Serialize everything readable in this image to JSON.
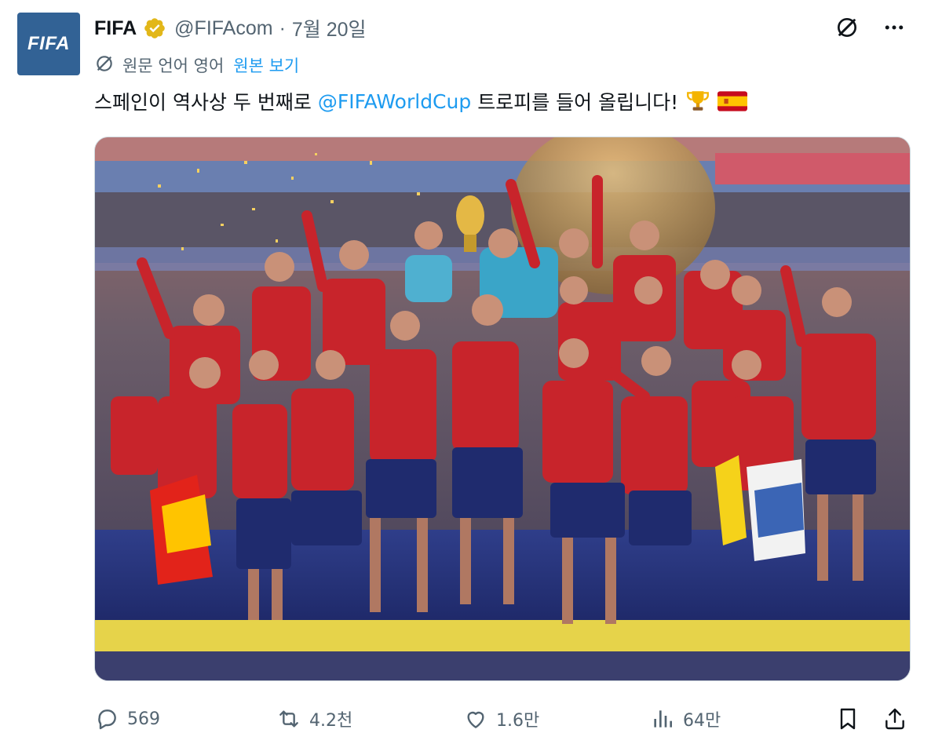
{
  "account": {
    "avatar_text": "FIFA",
    "name": "FIFA",
    "handle": "@FIFAcom",
    "separator": "·",
    "date": "7월 20일",
    "verified_color": "#e2b719",
    "avatar_color": "#326295"
  },
  "translation": {
    "source_label": "원문 언어 영어",
    "show_original": "원본 보기"
  },
  "tweet": {
    "text_before": "스페인이 역사상 두 번째로",
    "mention": "@FIFAWorldCup",
    "text_after": "트로피를 들어 올립니다!",
    "emojis": [
      "trophy-icon",
      "spain-flag-icon"
    ]
  },
  "media": {
    "description_icon": "photo"
  },
  "actions": {
    "replies": "569",
    "retweets": "4.2천",
    "likes": "1.6만",
    "views": "64만"
  },
  "colors": {
    "link": "#1d9bf0",
    "muted": "#536471",
    "text": "#0f1419"
  }
}
